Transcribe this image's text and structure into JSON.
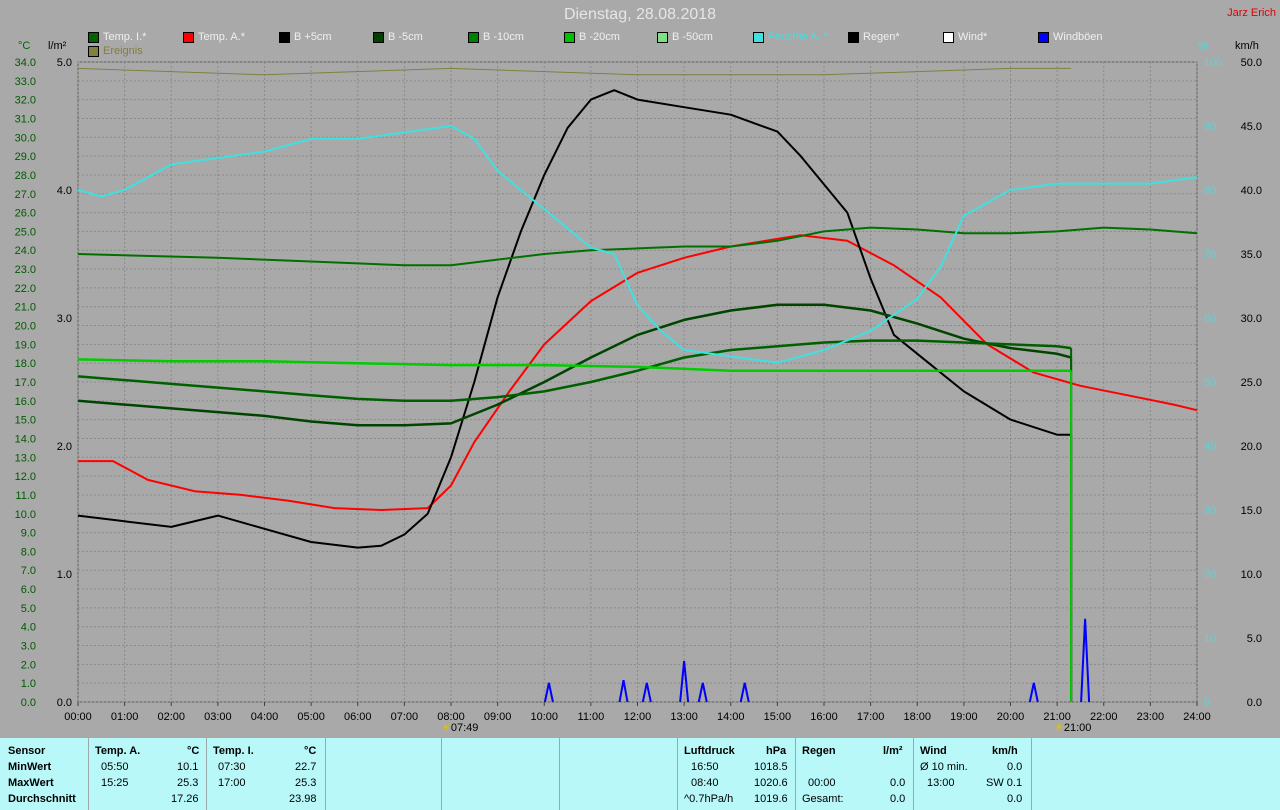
{
  "header": {
    "title": "Dienstag, 28.08.2018",
    "author": "Jarz Erich"
  },
  "legend": [
    {
      "label": "Temp. I.*",
      "color": "#006400"
    },
    {
      "label": "Temp. A.*",
      "color": "#ff0000"
    },
    {
      "label": "B +5cm",
      "color": "#000000"
    },
    {
      "label": "B -5cm",
      "color": "#004000"
    },
    {
      "label": "B -10cm",
      "color": "#008000"
    },
    {
      "label": "B -20cm",
      "color": "#00c000"
    },
    {
      "label": "B -50cm",
      "color": "#80e080"
    },
    {
      "label": "Feuchte A. *",
      "color": "#40e0e0"
    },
    {
      "label": "Regen*",
      "color": "#000000"
    },
    {
      "label": "Wind*",
      "color": "#ffffff"
    },
    {
      "label": "Windböen",
      "color": "#0000ff"
    },
    {
      "label": "Ereignis",
      "color": "#808040"
    }
  ],
  "axis_units": {
    "left_temp": "°C",
    "left_rain": "l/m²",
    "right_pct": "%",
    "right_wind": "km/h"
  },
  "markers": {
    "sunrise": "07:49",
    "sunset": "21:00"
  },
  "chart_data": {
    "type": "line",
    "x_unit": "hours",
    "x_ticks": [
      "00:00",
      "01:00",
      "02:00",
      "03:00",
      "04:00",
      "05:00",
      "06:00",
      "07:00",
      "08:00",
      "09:00",
      "10:00",
      "11:00",
      "12:00",
      "13:00",
      "14:00",
      "15:00",
      "16:00",
      "17:00",
      "18:00",
      "19:00",
      "20:00",
      "21:00",
      "22:00",
      "23:00",
      "24:00"
    ],
    "xlim": [
      0,
      24
    ],
    "temp_axis": {
      "ylim": [
        0,
        34
      ],
      "ticks": [
        "0.0",
        "1.0",
        "2.0",
        "3.0",
        "4.0",
        "5.0",
        "6.0",
        "7.0",
        "8.0",
        "9.0",
        "10.0",
        "11.0",
        "12.0",
        "13.0",
        "14.0",
        "15.0",
        "16.0",
        "17.0",
        "18.0",
        "19.0",
        "20.0",
        "21.0",
        "22.0",
        "23.0",
        "24.0",
        "25.0",
        "26.0",
        "27.0",
        "28.0",
        "29.0",
        "30.0",
        "31.0",
        "32.0",
        "33.0",
        "34.0"
      ]
    },
    "rain_axis": {
      "ylim": [
        0,
        5
      ],
      "ticks": [
        "0.0",
        "1.0",
        "2.0",
        "3.0",
        "4.0",
        "5.0"
      ]
    },
    "pct_axis": {
      "ylim": [
        0,
        100
      ],
      "ticks": [
        "0",
        "10",
        "20",
        "30",
        "40",
        "50",
        "60",
        "70",
        "80",
        "90",
        "100"
      ]
    },
    "wind_axis": {
      "ylim": [
        0,
        50
      ],
      "ticks": [
        "0.0",
        "5.0",
        "10.0",
        "15.0",
        "20.0",
        "25.0",
        "30.0",
        "35.0",
        "40.0",
        "45.0",
        "50.0"
      ]
    },
    "grid": true,
    "series": [
      {
        "name": "Temp. A.*",
        "color": "#ff0000",
        "axis": "temp",
        "end": 24,
        "points": [
          [
            0,
            12.8
          ],
          [
            0.75,
            12.8
          ],
          [
            1.5,
            11.8
          ],
          [
            2.5,
            11.2
          ],
          [
            3.5,
            11.0
          ],
          [
            4.5,
            10.7
          ],
          [
            5.5,
            10.3
          ],
          [
            6.5,
            10.2
          ],
          [
            7.5,
            10.3
          ],
          [
            8,
            11.5
          ],
          [
            8.5,
            13.8
          ],
          [
            9.25,
            16.5
          ],
          [
            10,
            19.0
          ],
          [
            11,
            21.3
          ],
          [
            12,
            22.8
          ],
          [
            13,
            23.6
          ],
          [
            14,
            24.2
          ],
          [
            15,
            24.6
          ],
          [
            15.5,
            24.8
          ],
          [
            16.5,
            24.5
          ],
          [
            17.5,
            23.2
          ],
          [
            18.5,
            21.5
          ],
          [
            19.5,
            19.0
          ],
          [
            20.5,
            17.5
          ],
          [
            21.5,
            16.8
          ],
          [
            22.5,
            16.3
          ],
          [
            23.5,
            15.8
          ],
          [
            24,
            15.5
          ]
        ]
      },
      {
        "name": "B +5cm",
        "color": "#000000",
        "axis": "temp",
        "end": 21.3,
        "points": [
          [
            0,
            9.9
          ],
          [
            1,
            9.6
          ],
          [
            2,
            9.3
          ],
          [
            3,
            9.9
          ],
          [
            4,
            9.2
          ],
          [
            5,
            8.5
          ],
          [
            6,
            8.2
          ],
          [
            6.5,
            8.3
          ],
          [
            7,
            8.9
          ],
          [
            7.5,
            10.0
          ],
          [
            8,
            13.0
          ],
          [
            8.5,
            17.0
          ],
          [
            9,
            21.5
          ],
          [
            9.5,
            25.0
          ],
          [
            10,
            28.0
          ],
          [
            10.5,
            30.5
          ],
          [
            11,
            32.0
          ],
          [
            11.5,
            32.5
          ],
          [
            12,
            32.0
          ],
          [
            13,
            31.6
          ],
          [
            14,
            31.2
          ],
          [
            15,
            30.3
          ],
          [
            15.5,
            29.0
          ],
          [
            16,
            27.5
          ],
          [
            16.5,
            26.0
          ],
          [
            17,
            22.5
          ],
          [
            17.5,
            19.5
          ],
          [
            18,
            18.5
          ],
          [
            19,
            16.5
          ],
          [
            20,
            15.0
          ],
          [
            21,
            14.2
          ],
          [
            21.3,
            14.2
          ]
        ]
      },
      {
        "name": "Temp. I.*",
        "color": "#007000",
        "axis": "temp",
        "end": 24,
        "points": [
          [
            0,
            23.8
          ],
          [
            3,
            23.6
          ],
          [
            5,
            23.4
          ],
          [
            7,
            23.2
          ],
          [
            8,
            23.2
          ],
          [
            9,
            23.5
          ],
          [
            10,
            23.8
          ],
          [
            11,
            24.0
          ],
          [
            12,
            24.1
          ],
          [
            13,
            24.2
          ],
          [
            14,
            24.2
          ],
          [
            15,
            24.5
          ],
          [
            16,
            25.0
          ],
          [
            17,
            25.2
          ],
          [
            18,
            25.1
          ],
          [
            19,
            24.9
          ],
          [
            20,
            24.9
          ],
          [
            21,
            25.0
          ],
          [
            22,
            25.2
          ],
          [
            23,
            25.1
          ],
          [
            24,
            24.9
          ]
        ]
      },
      {
        "name": "B -5cm",
        "color": "#004400",
        "axis": "temp",
        "end": 21.3,
        "points": [
          [
            0,
            16.0
          ],
          [
            1,
            15.8
          ],
          [
            2,
            15.6
          ],
          [
            3,
            15.4
          ],
          [
            4,
            15.2
          ],
          [
            5,
            14.9
          ],
          [
            6,
            14.7
          ],
          [
            7,
            14.7
          ],
          [
            8,
            14.8
          ],
          [
            9,
            15.8
          ],
          [
            10,
            17.0
          ],
          [
            11,
            18.3
          ],
          [
            12,
            19.5
          ],
          [
            13,
            20.3
          ],
          [
            14,
            20.8
          ],
          [
            15,
            21.1
          ],
          [
            16,
            21.1
          ],
          [
            17,
            20.8
          ],
          [
            18,
            20.1
          ],
          [
            19,
            19.3
          ],
          [
            20,
            18.8
          ],
          [
            21,
            18.5
          ],
          [
            21.3,
            18.3
          ]
        ]
      },
      {
        "name": "B -10cm",
        "color": "#006000",
        "axis": "temp",
        "end": 21.3,
        "points": [
          [
            0,
            17.3
          ],
          [
            1,
            17.1
          ],
          [
            2,
            16.9
          ],
          [
            3,
            16.7
          ],
          [
            4,
            16.5
          ],
          [
            5,
            16.3
          ],
          [
            6,
            16.1
          ],
          [
            7,
            16.0
          ],
          [
            8,
            16.0
          ],
          [
            9,
            16.2
          ],
          [
            10,
            16.5
          ],
          [
            11,
            17.0
          ],
          [
            12,
            17.6
          ],
          [
            13,
            18.3
          ],
          [
            14,
            18.7
          ],
          [
            15,
            18.9
          ],
          [
            16,
            19.1
          ],
          [
            17,
            19.2
          ],
          [
            18,
            19.2
          ],
          [
            19,
            19.1
          ],
          [
            20,
            19.0
          ],
          [
            21,
            18.9
          ],
          [
            21.3,
            18.8
          ]
        ]
      },
      {
        "name": "B -20cm",
        "color": "#00cc00",
        "axis": "temp",
        "end": 21.3,
        "points": [
          [
            0,
            18.2
          ],
          [
            2,
            18.1
          ],
          [
            4,
            18.1
          ],
          [
            6,
            18.0
          ],
          [
            8,
            17.9
          ],
          [
            10,
            17.9
          ],
          [
            12,
            17.8
          ],
          [
            14,
            17.6
          ],
          [
            16,
            17.6
          ],
          [
            18,
            17.6
          ],
          [
            20,
            17.6
          ],
          [
            21.3,
            17.6
          ]
        ]
      },
      {
        "name": "Feuchte A. *",
        "color": "#40e0e0",
        "axis": "pct",
        "end": 24,
        "points": [
          [
            0,
            80
          ],
          [
            0.5,
            79
          ],
          [
            1,
            80
          ],
          [
            1.5,
            82
          ],
          [
            2,
            84
          ],
          [
            3,
            85
          ],
          [
            4,
            86
          ],
          [
            5,
            88
          ],
          [
            6,
            88
          ],
          [
            7,
            89
          ],
          [
            8,
            90
          ],
          [
            8.5,
            88
          ],
          [
            9,
            83
          ],
          [
            9.5,
            80
          ],
          [
            10,
            77
          ],
          [
            10.5,
            74
          ],
          [
            11,
            71
          ],
          [
            11.5,
            70
          ],
          [
            12,
            62
          ],
          [
            12.5,
            58
          ],
          [
            13,
            55
          ],
          [
            14,
            54
          ],
          [
            15,
            53
          ],
          [
            16,
            55
          ],
          [
            17,
            58
          ],
          [
            18,
            63
          ],
          [
            18.5,
            68
          ],
          [
            19,
            76
          ],
          [
            20,
            80
          ],
          [
            21,
            81
          ],
          [
            22,
            81
          ],
          [
            23,
            81
          ],
          [
            24,
            82
          ]
        ]
      },
      {
        "name": "Ereignis",
        "color": "#808040",
        "axis": "pct",
        "end": 21.3,
        "points": [
          [
            0,
            99
          ],
          [
            4,
            98
          ],
          [
            8,
            99
          ],
          [
            12,
            98
          ],
          [
            16,
            98
          ],
          [
            20,
            99
          ],
          [
            21.3,
            99
          ]
        ]
      }
    ],
    "gusts": [
      {
        "t": 10.1,
        "v": 1.5
      },
      {
        "t": 11.7,
        "v": 1.7
      },
      {
        "t": 12.2,
        "v": 1.5
      },
      {
        "t": 13.0,
        "v": 3.2
      },
      {
        "t": 13.4,
        "v": 1.5
      },
      {
        "t": 14.3,
        "v": 1.5
      },
      {
        "t": 20.5,
        "v": 1.5
      },
      {
        "t": 21.6,
        "v": 6.5
      }
    ]
  },
  "summary": {
    "sensor_label": "Sensor",
    "row_labels": [
      "MinWert",
      "MaxWert",
      "Durchschnitt"
    ],
    "temp_a": {
      "label": "Temp. A.",
      "unit": "°C",
      "min_time": "05:50",
      "min_val": "10.1",
      "max_time": "15:25",
      "max_val": "25.3",
      "avg": "17.26"
    },
    "temp_i": {
      "label": "Temp. I.",
      "unit": "°C",
      "min_time": "07:30",
      "min_val": "22.7",
      "max_time": "17:00",
      "max_val": "25.3",
      "avg": "23.98"
    },
    "pressure": {
      "label": "Luftdruck",
      "unit": "hPa",
      "min_time": "16:50",
      "min_val": "1018.5",
      "max_time": "08:40",
      "max_val": "1020.6",
      "trend_label": "^0.7hPa/h",
      "trend_val": "1019.6"
    },
    "rain": {
      "label": "Regen",
      "unit": "l/m²",
      "r2_time": "00:00",
      "r2_val": "0.0",
      "total_label": "Gesamt:",
      "total_val": "0.0"
    },
    "wind": {
      "label": "Wind",
      "unit": "km/h",
      "avg_label": "Ø 10 min.",
      "avg_val": "0.0",
      "time": "13:00",
      "dir_val": "SW 0.1",
      "r3_val": "0.0"
    }
  }
}
